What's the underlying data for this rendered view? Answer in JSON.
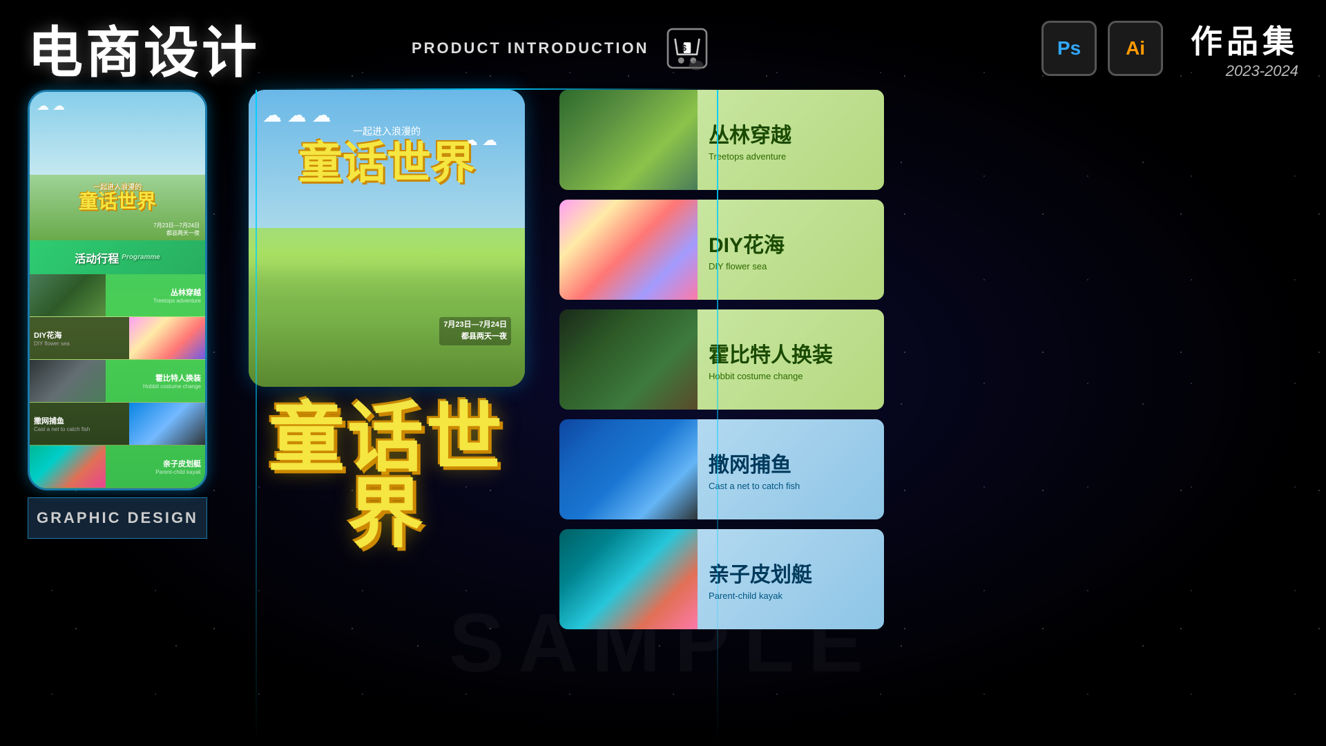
{
  "header": {
    "title_zh": "电商设计",
    "product_intro": "PRODUCT INTRODUCTION",
    "portfolio_zh": "作品集",
    "portfolio_year": "2023-2024",
    "ps_label": "Ps",
    "ai_label": "Ai"
  },
  "left_panel": {
    "graphic_design_label": "GRAPHIC DESIGN",
    "phone": {
      "hero_top_text": "一起进入浪漫的",
      "hero_main_zh": "童话世界",
      "date_line1": "7月23日—7月24日",
      "date_line2": "都县两天一夜",
      "itinerary_zh": "活动行程",
      "itinerary_en": "Programme",
      "items": [
        {
          "zh": "丛林穿越",
          "en": "Treetops adventure"
        },
        {
          "zh": "DIY花海",
          "en": "DIY flower sea"
        },
        {
          "zh": "霍比特人换装",
          "en": "Hobbit costume change"
        },
        {
          "zh": "撒网捕鱼",
          "en": "Cast a net to catch fish"
        },
        {
          "zh": "亲子皮划艇",
          "en": "Parent-child kayak"
        }
      ]
    }
  },
  "middle_panel": {
    "main_card": {
      "top_line": "一起进入浪漫的",
      "main_zh": "童话世界",
      "date_line1": "7月23日—7月24日",
      "date_line2": "都县两天一夜"
    },
    "large_title": "童话世界"
  },
  "right_panel": {
    "activities": [
      {
        "zh": "丛林穿越",
        "en": "Treetops adventure",
        "bg_type": "forest"
      },
      {
        "zh": "DIY花海",
        "en": "DIY flower sea",
        "bg_type": "flower"
      },
      {
        "zh": "霍比特人换装",
        "en": "Hobbit costume change",
        "bg_type": "hobbit"
      },
      {
        "zh": "撒网捕鱼",
        "en": "Cast a net to catch fish",
        "bg_type": "fish"
      },
      {
        "zh": "亲子皮划艇",
        "en": "Parent-child kayak",
        "bg_type": "kayak"
      }
    ]
  },
  "watermark": "SAMPLE"
}
